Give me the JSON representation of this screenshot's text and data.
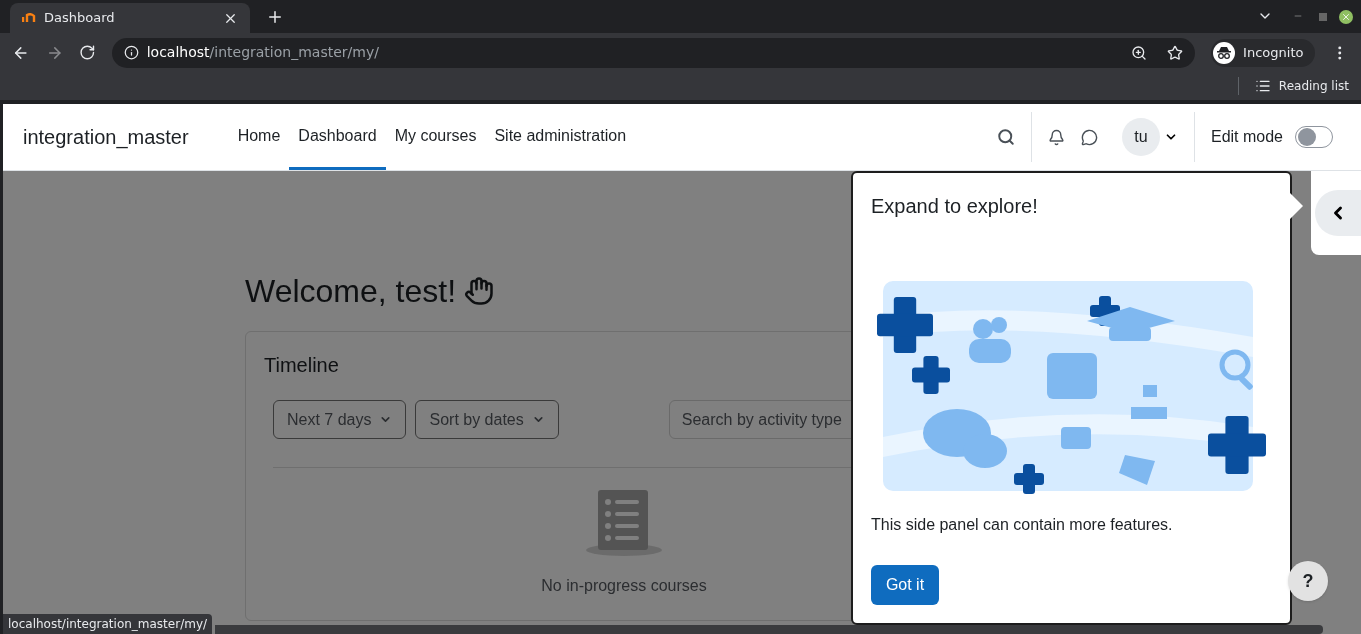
{
  "browser": {
    "tab_title": "Dashboard",
    "url_host": "localhost",
    "url_path": "/integration_master/my/",
    "profile": "Incognito",
    "reading_list": "Reading list",
    "status_url": "localhost/integration_master/my/"
  },
  "site": {
    "brand": "integration_master",
    "nav": [
      {
        "label": "Home",
        "selected": false
      },
      {
        "label": "Dashboard",
        "selected": true
      },
      {
        "label": "My courses",
        "selected": false
      },
      {
        "label": "Site administration",
        "selected": false
      }
    ],
    "user_initials": "tu",
    "edit_mode": {
      "label": "Edit mode",
      "on": false
    }
  },
  "main": {
    "heading": "Welcome, test!",
    "timeline": {
      "title": "Timeline",
      "filters": [
        "Next 7 days",
        "Sort by dates"
      ],
      "search_placeholder": "Search by activity type",
      "empty_text": "No in-progress courses"
    }
  },
  "popover": {
    "title": "Expand to explore!",
    "body": "This side panel can contain more features.",
    "button": "Got it"
  },
  "help": "?"
}
